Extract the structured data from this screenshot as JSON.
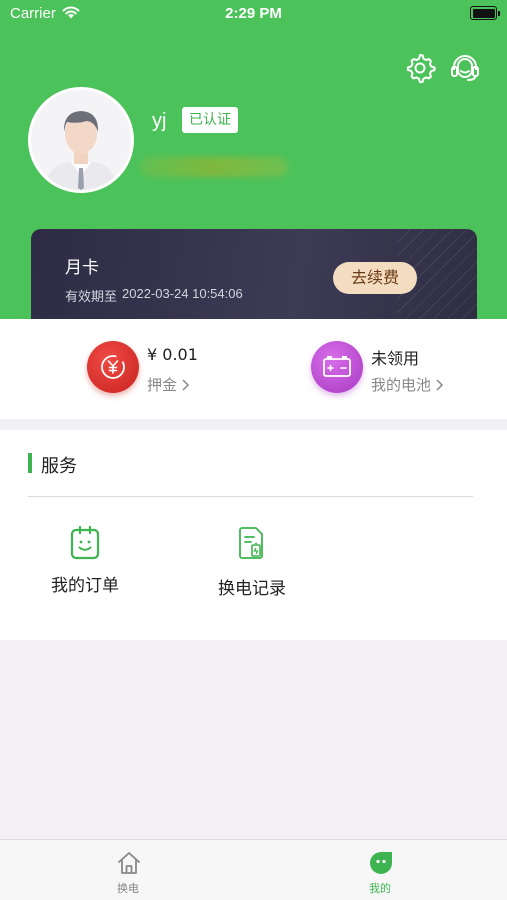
{
  "status_bar": {
    "carrier": "Carrier",
    "time": "2:29 PM"
  },
  "header": {
    "settings_icon": "gear-icon",
    "service_icon": "headset-icon"
  },
  "profile": {
    "username": "yj",
    "verified_label": "已认证"
  },
  "card": {
    "title": "月卡",
    "expiry_label": "有效期至",
    "expiry_date": "2022-03-24 10:54:06",
    "renew_label": "去续费"
  },
  "wallet": {
    "deposit": {
      "value": "¥ 0.01",
      "label": "押金",
      "icon": "yuan-icon"
    },
    "battery": {
      "value": "未领用",
      "label": "我的电池",
      "icon": "battery-icon"
    }
  },
  "services": {
    "title": "服务",
    "items": [
      {
        "label": "我的订单",
        "icon": "order-icon"
      },
      {
        "label": "换电记录",
        "icon": "record-icon"
      }
    ]
  },
  "tabbar": {
    "tabs": [
      {
        "label": "换电",
        "icon": "home-icon",
        "active": false
      },
      {
        "label": "我的",
        "icon": "profile-icon",
        "active": true
      }
    ]
  },
  "colors": {
    "primary": "#4cc25b",
    "accent": "#3db44f",
    "card_dark": "#2d2c44",
    "renew_bg": "#f3dcc0"
  }
}
